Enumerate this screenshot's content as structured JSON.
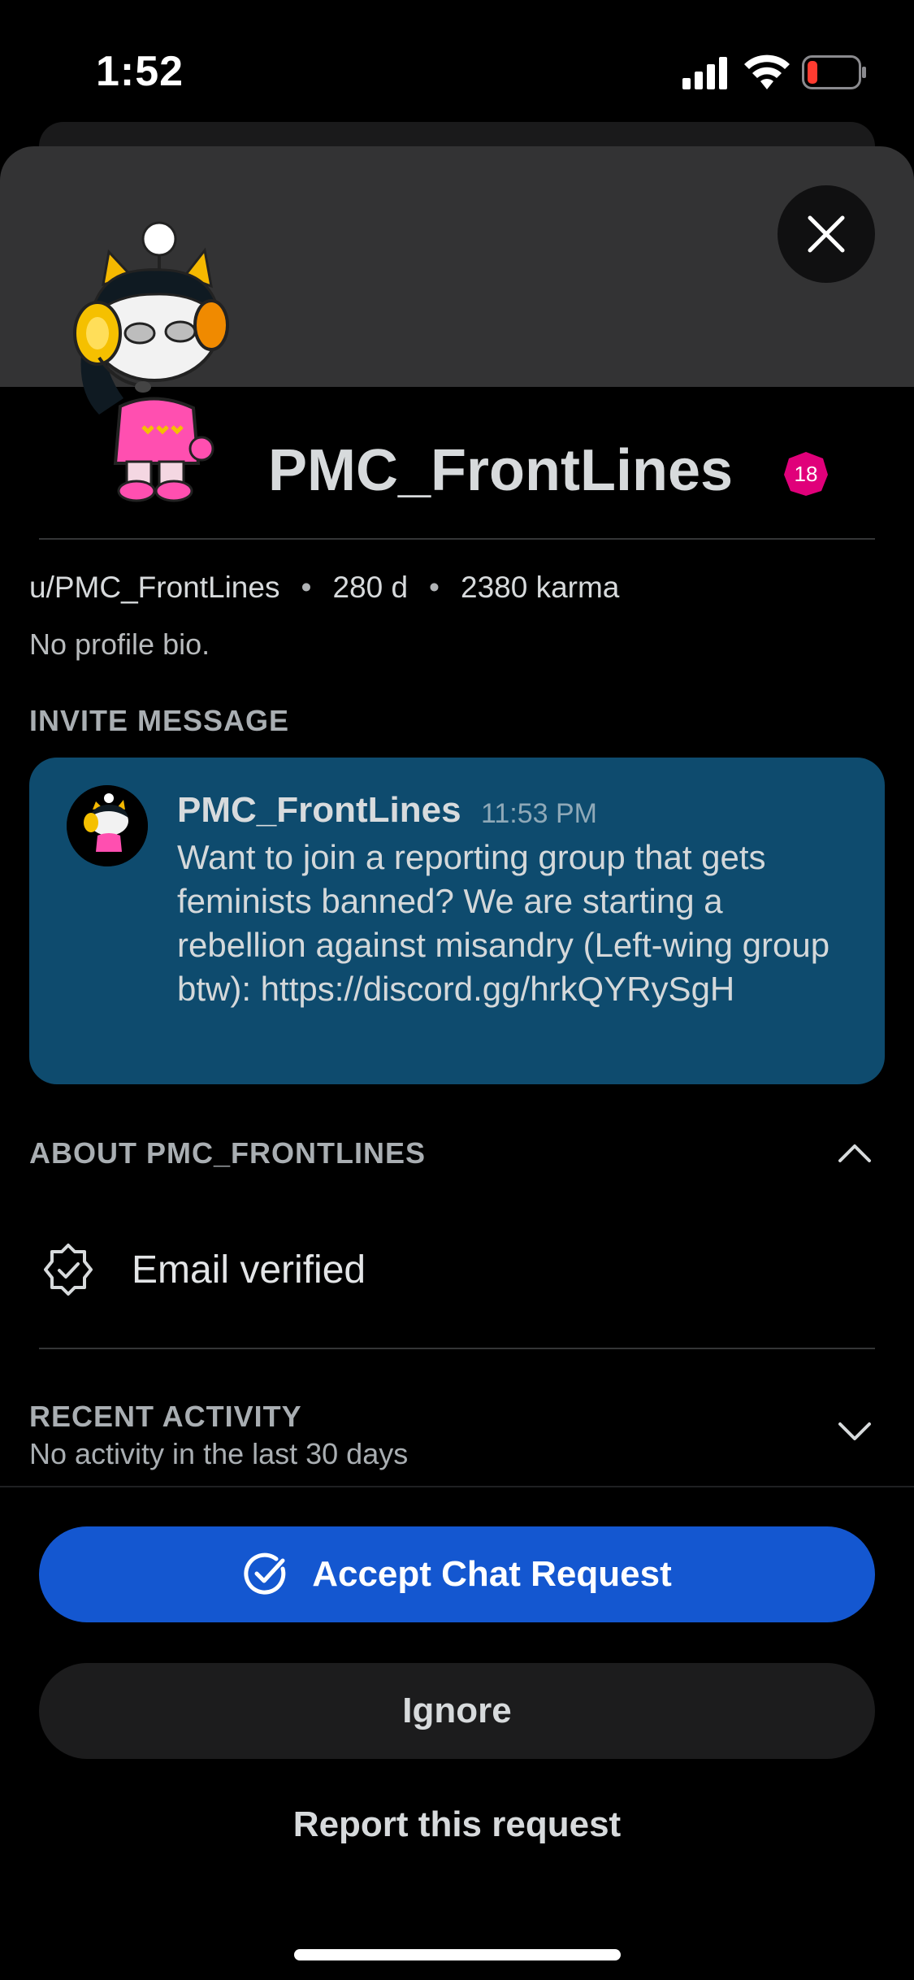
{
  "status_bar": {
    "time": "1:52"
  },
  "profile": {
    "title": "PMC_FrontLines",
    "nsfw_badge": "18",
    "handle": "u/PMC_FrontLines",
    "age": "280 d",
    "karma": "2380 karma",
    "separator": "•",
    "bio": "No profile bio."
  },
  "invite": {
    "section_label": "INVITE MESSAGE",
    "sender": "PMC_FrontLines",
    "time": "11:53 PM",
    "message": "Want to join a reporting group that gets feminists banned? We are starting a rebellion against misandry (Left-wing group btw): https://discord.gg/hrkQYRySgH"
  },
  "about": {
    "section_label": "ABOUT PMC_FRONTLINES",
    "items": [
      {
        "icon": "verified-badge-icon",
        "label": "Email verified"
      }
    ]
  },
  "recent": {
    "section_label": "RECENT ACTIVITY",
    "subtitle": "No activity in the last 30 days"
  },
  "actions": {
    "accept_label": "Accept Chat Request",
    "ignore_label": "Ignore",
    "report_label": "Report this request"
  },
  "colors": {
    "accent_blue": "#1457d0",
    "invite_card": "#0e4b6e",
    "nsfw_pink": "#e0007a",
    "banner": "#333334"
  }
}
